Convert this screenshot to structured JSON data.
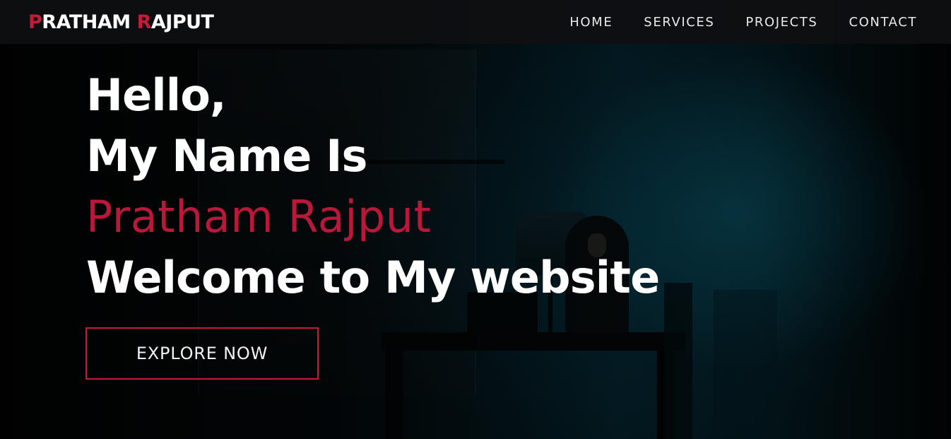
{
  "navbar": {
    "logo": {
      "first_initial": "P",
      "first_rest": "RATHAM ",
      "last_initial": "R",
      "last_rest": "AJPUT"
    },
    "links": [
      "HOME",
      "SERVICES",
      "PROJECTS",
      "CONTACT"
    ]
  },
  "hero": {
    "line1": "Hello,",
    "line2": "My Name Is",
    "name": "Pratham Rajput",
    "line4": "Welcome to My website",
    "cta_label": "EXPLORE NOW"
  },
  "colors": {
    "accent": "#c41b3b",
    "name_text": "#b8183a",
    "navbar_bg": "#0e0f11",
    "text": "#ffffff"
  }
}
